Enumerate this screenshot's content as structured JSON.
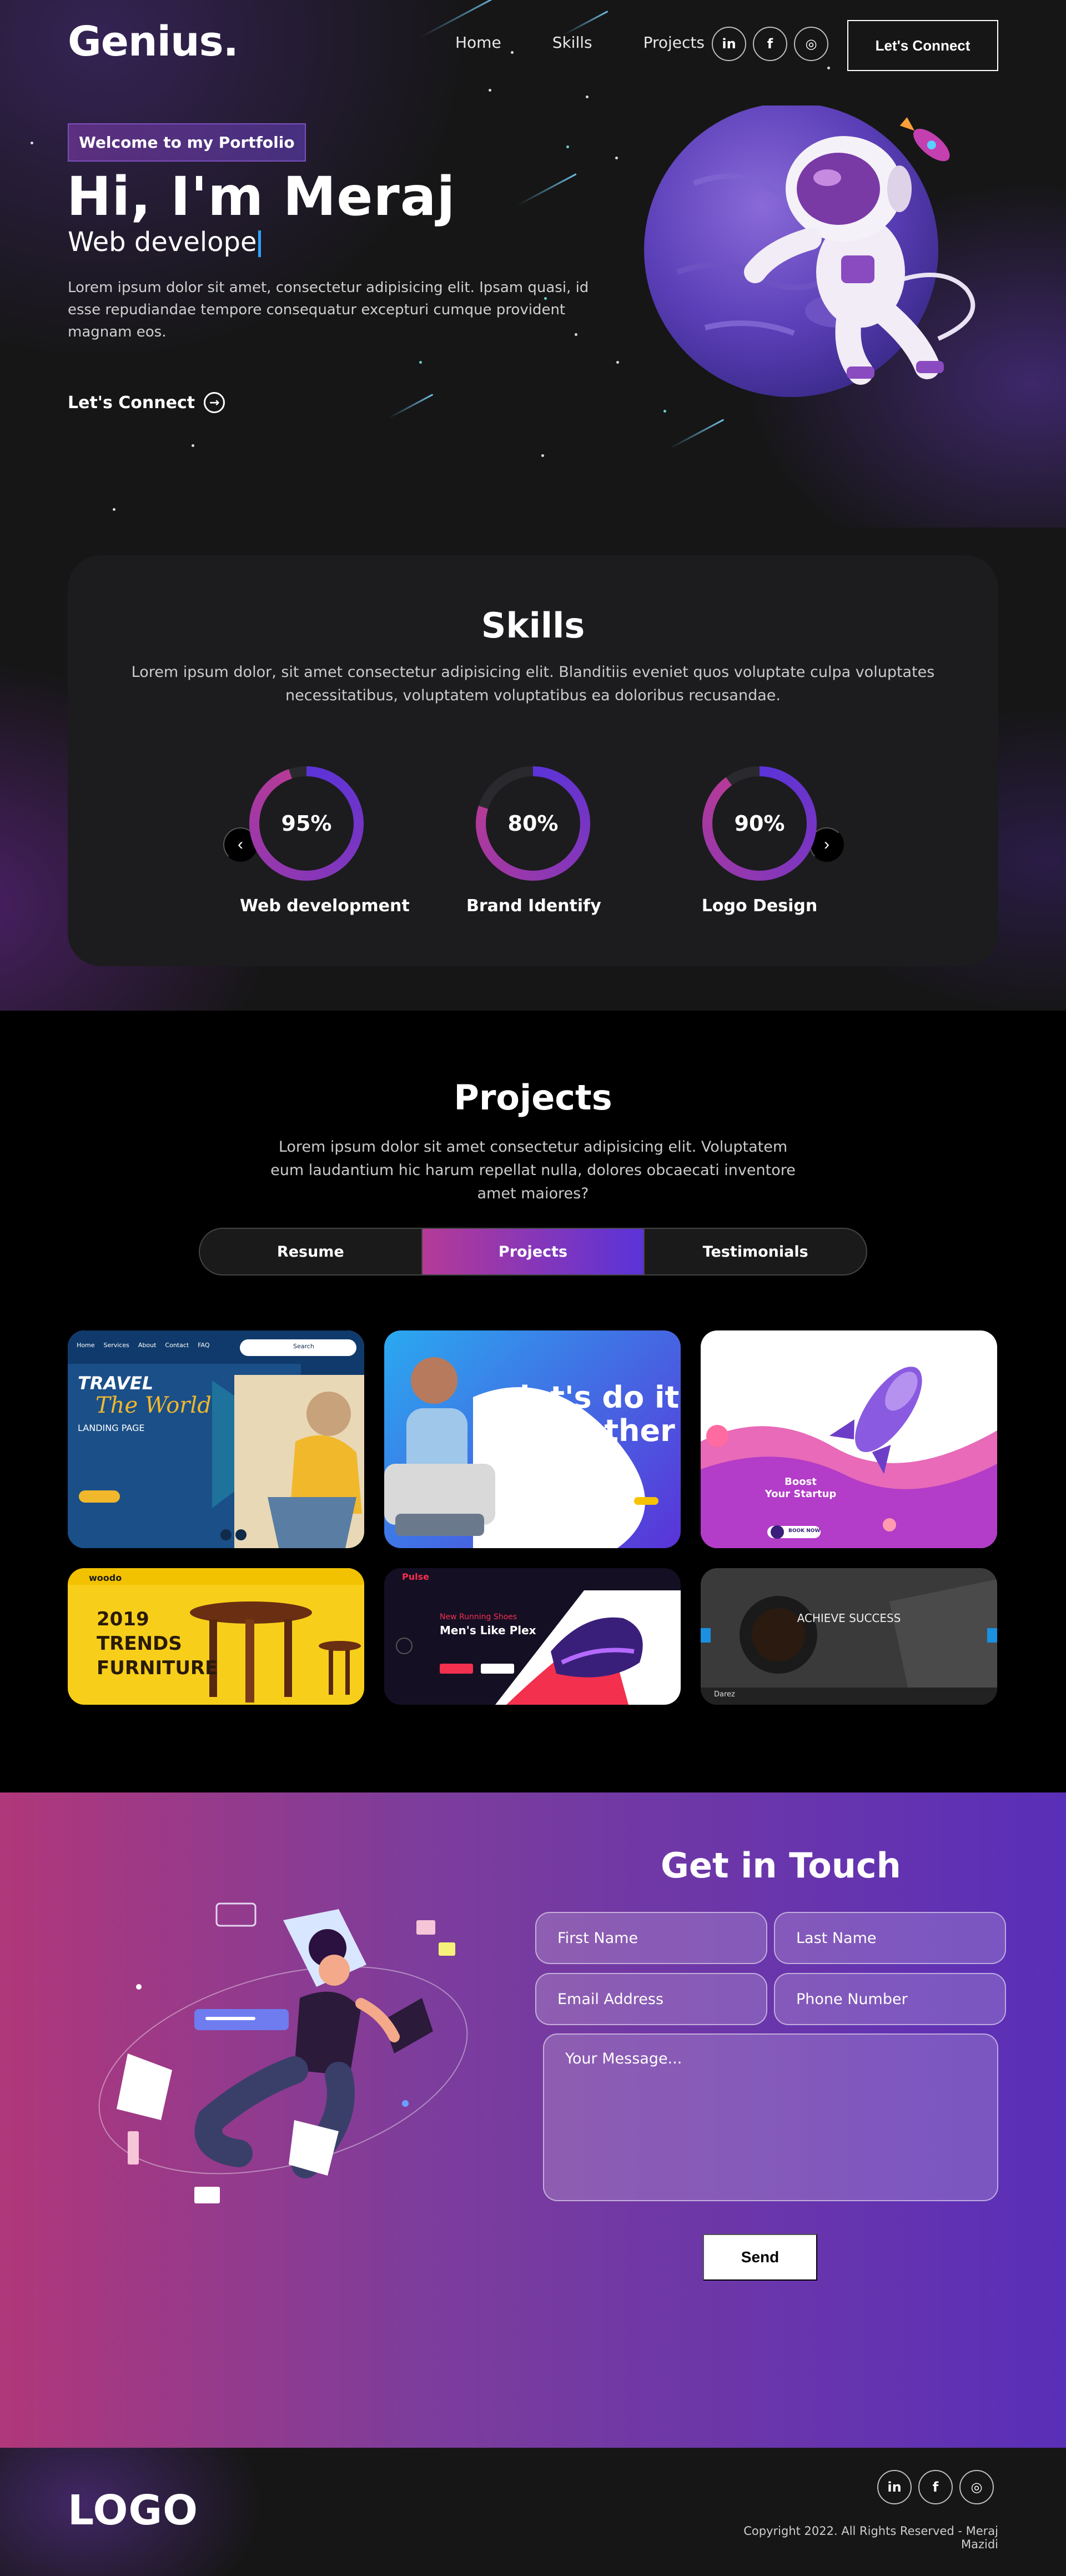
{
  "nav": {
    "logo": "Genius.",
    "links": [
      "Home",
      "Skills",
      "Projects"
    ],
    "social": [
      "in",
      "f",
      "◎"
    ],
    "connect_button": "Let's Connect"
  },
  "hero": {
    "badge": "Welcome to my Portfolio",
    "heading": "Hi, I'm Meraj",
    "role": "Web develope",
    "lead": "Lorem ipsum dolor sit amet, consectetur adipisicing elit. Ipsam quasi, id esse repudiandae tempore consequatur excepturi cumque provident magnam eos.",
    "cta": "Let's Connect",
    "cta_icon": "arrow-right-circle-icon"
  },
  "skills": {
    "title": "Skills",
    "description": "Lorem ipsum dolor, sit amet consectetur adipisicing elit. Blanditiis eveniet quos voluptate culpa voluptates necessitatibus, voluptatem voluptatibus ea doloribus recusandae.",
    "items": [
      {
        "label": "Web development",
        "value": "95%",
        "percent": 95
      },
      {
        "label": "Brand Identify",
        "value": "80%",
        "percent": 80
      },
      {
        "label": "Logo Design",
        "value": "90%",
        "percent": 90
      }
    ],
    "prev": "‹",
    "next": "›"
  },
  "projects": {
    "title": "Projects",
    "description": "Lorem ipsum dolor sit amet consectetur adipisicing elit. Voluptatem eum laudantium hic harum repellat nulla, dolores obcaecati inventore amet maiores?",
    "tabs": [
      "Resume",
      "Projects",
      "Testimonials"
    ],
    "active_tab": "Projects",
    "cards": {
      "travel": {
        "title1": "TRAVEL",
        "title2": "The World",
        "sub": "LANDING PAGE",
        "nav": [
          "Home",
          "Services",
          "About",
          "Contact",
          "FAQ"
        ],
        "search": "Search"
      },
      "together": {
        "line1": "let's do it",
        "line2": "together"
      },
      "boost": {
        "line1": "Boost",
        "line2": "Your Startup",
        "button": "BOOK NOW"
      },
      "furniture": {
        "brand": "woodo",
        "year": "2019",
        "line1": "TRENDS",
        "line2": "FURNITURE"
      },
      "shoes": {
        "brand": "Pulse",
        "kicker": "New Running Shoes",
        "title": "Men's Like Plex"
      },
      "success": {
        "title": "ACHIEVE SUCCESS",
        "brand": "Darez"
      }
    }
  },
  "contact": {
    "title": "Get in Touch",
    "first_name": "First Name",
    "last_name": "Last Name",
    "email": "Email Address",
    "phone": "Phone Number",
    "message": "Your Message...",
    "send": "Send"
  },
  "footer": {
    "logo": "LOGO",
    "social": [
      "in",
      "f",
      "◎"
    ],
    "copyright": "Copyright 2022. All Rights Reserved - Meraj Mazidi"
  },
  "colors": {
    "accent_purple": "#5a33d8",
    "accent_pink": "#b53a97",
    "hero_bg": "#161616",
    "blue_glow": "#2882ff"
  }
}
